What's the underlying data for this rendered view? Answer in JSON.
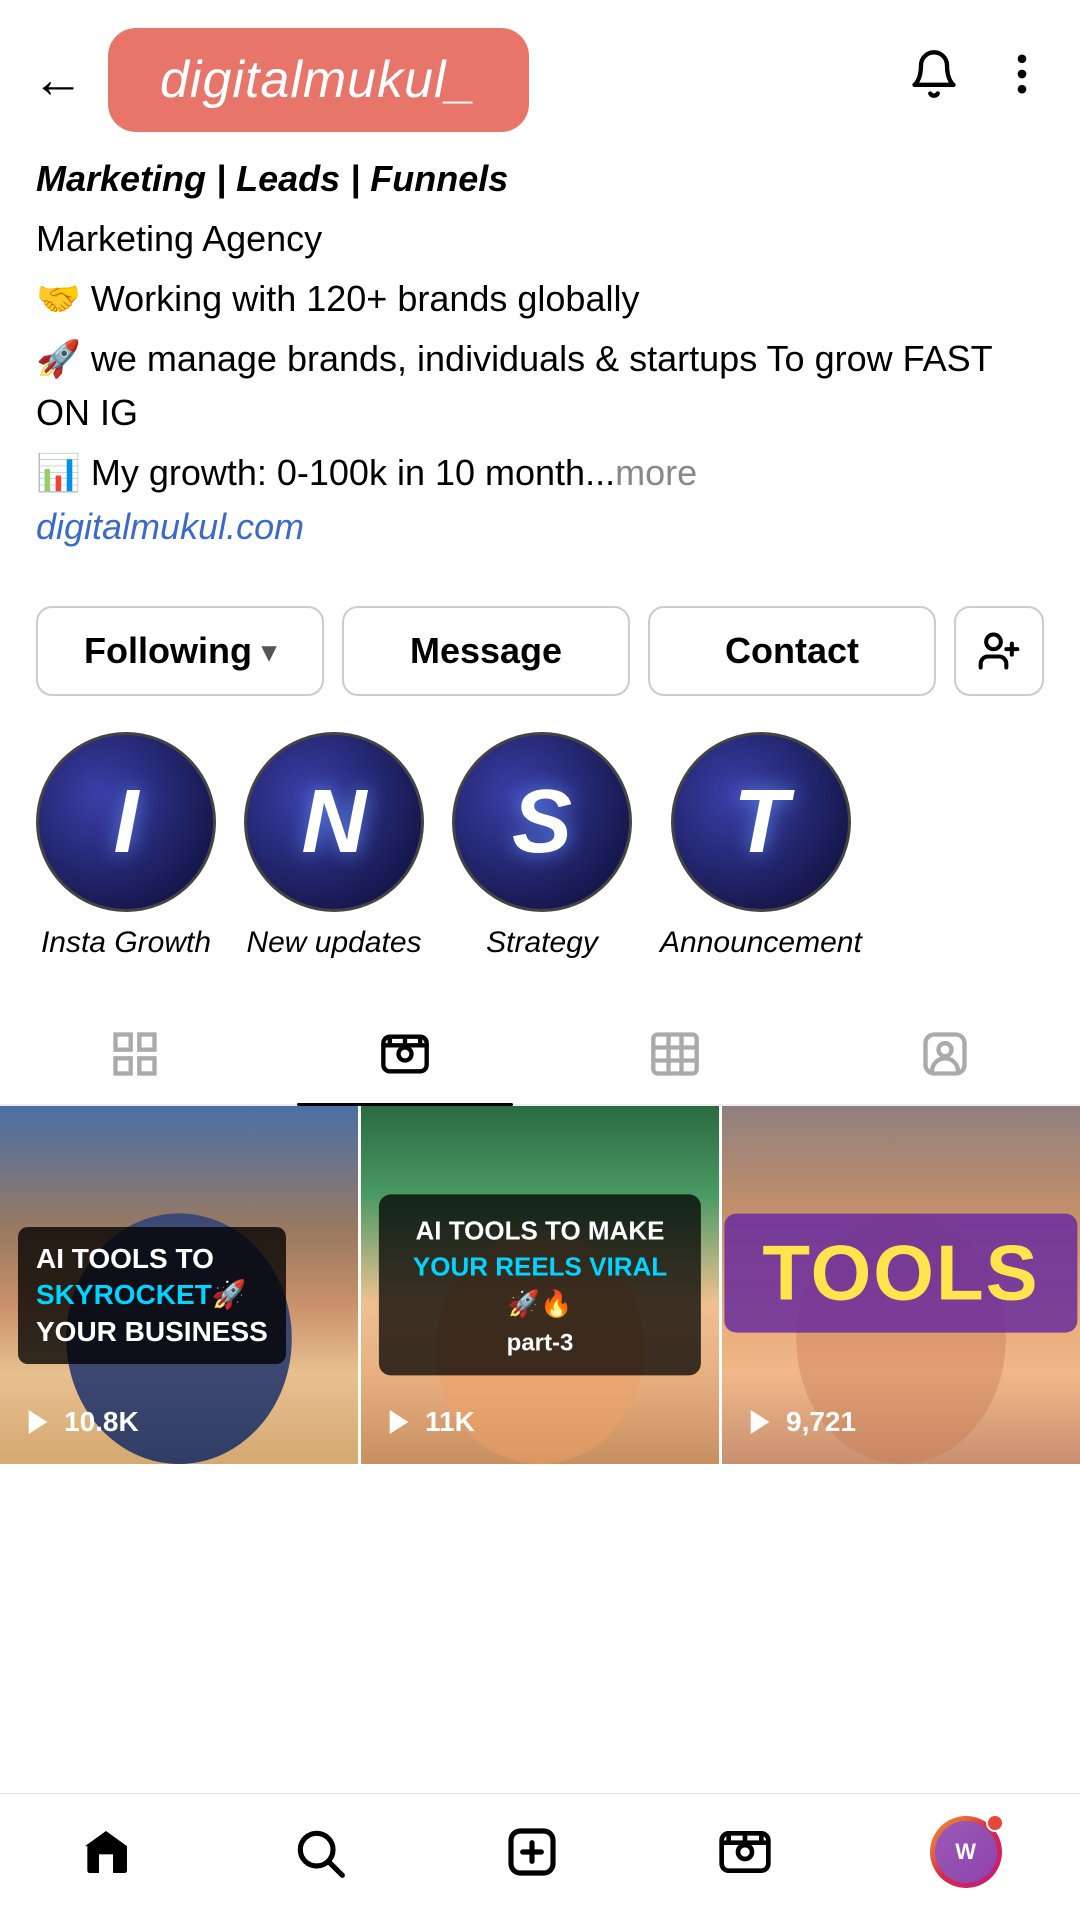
{
  "header": {
    "back_label": "←",
    "username": "digitalmukul_",
    "notification_icon": "bell",
    "more_icon": "ellipsis"
  },
  "profile": {
    "bio_title": "Marketing | Leads | Funnels",
    "bio_category": "Marketing Agency",
    "bio_line1": "🤝 Working with 120+ brands globally",
    "bio_line2": "🚀 we manage brands, individuals & startups To grow FAST ON IG",
    "bio_line3": "📊 My growth: 0-100k  in 10 month...",
    "more_label": "more",
    "website": "digitalmukul.com",
    "website_url": "https://digitalmukul.com"
  },
  "actions": {
    "following_label": "Following",
    "message_label": "Message",
    "contact_label": "Contact",
    "add_icon": "+👤"
  },
  "highlights": [
    {
      "letter": "I",
      "label": "Insta Growth"
    },
    {
      "letter": "N",
      "label": "New updates"
    },
    {
      "letter": "S",
      "label": "Strategy"
    },
    {
      "letter": "T",
      "label": "Announcement"
    }
  ],
  "tabs": [
    {
      "id": "grid",
      "icon": "grid",
      "active": false
    },
    {
      "id": "reels",
      "icon": "reels",
      "active": true
    },
    {
      "id": "collab",
      "icon": "collab",
      "active": false
    },
    {
      "id": "tagged",
      "icon": "tagged",
      "active": false
    }
  ],
  "reels": [
    {
      "text_line1": "AI TOOLS TO",
      "text_line2": "SKYROCKET🚀",
      "text_line3": "YOUR BUSINESS",
      "count": "10.8K"
    },
    {
      "text_line1": "AI TOOLS TO MAKE",
      "text_line2": "YOUR REELS VIRAL🚀🔥",
      "text_line3": "part-3",
      "count": "11K"
    },
    {
      "text_main": "TOOLS",
      "count": "9,721"
    }
  ],
  "bottom_nav": {
    "home_icon": "home",
    "search_icon": "search",
    "create_icon": "plus",
    "reels_icon": "reels",
    "profile_icon": "wishker"
  }
}
